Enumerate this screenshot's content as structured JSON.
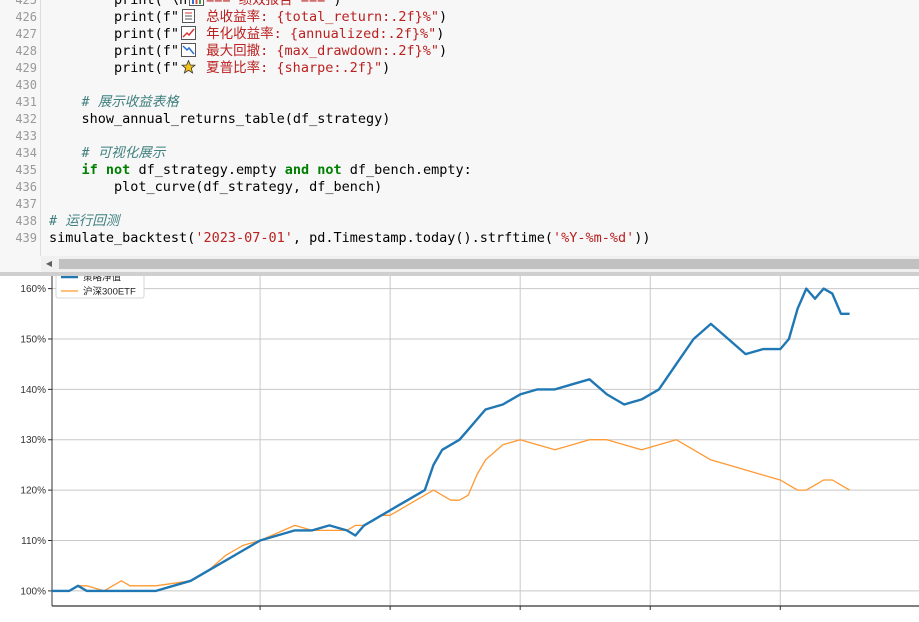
{
  "editor": {
    "lines": [
      {
        "n": "425",
        "parts": [
          [
            "",
            "        print(\"\\n"
          ],
          [
            "ic:bar",
            ""
          ],
          [
            "str",
            "=== 绩效报告 ===\""
          ],
          [
            "",
            ")"
          ]
        ]
      },
      {
        "n": "426",
        "parts": [
          [
            "",
            "        print(f\""
          ],
          [
            "ic:doc",
            ""
          ],
          [
            "str",
            " 总收益率: {total_return:.2f}%\""
          ],
          [
            "",
            ")"
          ]
        ]
      },
      {
        "n": "427",
        "parts": [
          [
            "",
            "        print(f\""
          ],
          [
            "ic:up",
            ""
          ],
          [
            "str",
            " 年化收益率: {annualized:.2f}%\""
          ],
          [
            "",
            ")"
          ]
        ]
      },
      {
        "n": "428",
        "parts": [
          [
            "",
            "        print(f\""
          ],
          [
            "ic:down",
            ""
          ],
          [
            "str",
            " 最大回撤: {max_drawdown:.2f}%\""
          ],
          [
            "",
            ")"
          ]
        ]
      },
      {
        "n": "429",
        "parts": [
          [
            "",
            "        print(f\""
          ],
          [
            "ic:star",
            ""
          ],
          [
            "str",
            " 夏普比率: {sharpe:.2f}\""
          ],
          [
            "",
            ")"
          ]
        ]
      },
      {
        "n": "430",
        "parts": []
      },
      {
        "n": "431",
        "parts": [
          [
            "",
            "    "
          ],
          [
            "cm",
            "# 展示收益表格"
          ]
        ]
      },
      {
        "n": "432",
        "parts": [
          [
            "",
            "    show_annual_returns_table(df_strategy)"
          ]
        ]
      },
      {
        "n": "433",
        "parts": []
      },
      {
        "n": "434",
        "parts": [
          [
            "",
            "    "
          ],
          [
            "cm",
            "# 可视化展示"
          ]
        ]
      },
      {
        "n": "435",
        "parts": [
          [
            "",
            "    "
          ],
          [
            "kw",
            "if"
          ],
          [
            "",
            " "
          ],
          [
            "kw",
            "not"
          ],
          [
            "",
            " df_strategy.empty "
          ],
          [
            "kw",
            "and"
          ],
          [
            "",
            " "
          ],
          [
            "kw",
            "not"
          ],
          [
            "",
            " df_bench.empty:"
          ]
        ]
      },
      {
        "n": "436",
        "parts": [
          [
            "",
            "        plot_curve(df_strategy, df_bench)"
          ]
        ]
      },
      {
        "n": "437",
        "parts": []
      },
      {
        "n": "438",
        "parts": [
          [
            "cm",
            "# 运行回测"
          ]
        ]
      },
      {
        "n": "439",
        "parts": [
          [
            "",
            "simulate_backtest("
          ],
          [
            "str",
            "'2023-07-01'"
          ],
          [
            "",
            ", pd.Timestamp.today().strftime("
          ],
          [
            "str",
            "'%Y-%m-%d'"
          ],
          [
            "",
            "))"
          ]
        ]
      }
    ],
    "scroll_left_glyph": "◀"
  },
  "chart_data": {
    "type": "line",
    "ylim": [
      0.97,
      1.625
    ],
    "xlim": [
      0,
      1000
    ],
    "yticks": [
      1.0,
      1.1,
      1.2,
      1.3,
      1.4,
      1.5,
      1.6
    ],
    "ytick_labels": [
      "100%",
      "110%",
      "120%",
      "130%",
      "140%",
      "150%",
      "160%"
    ],
    "xgrid": [
      240,
      390,
      540,
      690,
      840
    ],
    "grid": true,
    "legend": "top-left",
    "xlabel": "",
    "ylabel": "",
    "title": "",
    "series": [
      {
        "name": "策略净值",
        "color": "#1f77b4",
        "width": 2.4,
        "x": [
          0,
          20,
          30,
          40,
          60,
          70,
          80,
          90,
          120,
          160,
          180,
          200,
          220,
          240,
          280,
          300,
          320,
          340,
          350,
          360,
          370,
          380,
          390,
          400,
          410,
          420,
          430,
          440,
          450,
          460,
          470,
          480,
          490,
          500,
          520,
          540,
          560,
          580,
          600,
          620,
          640,
          660,
          680,
          700,
          720,
          740,
          760,
          780,
          800,
          820,
          840,
          850,
          860,
          870,
          880,
          890,
          900,
          910,
          920
        ],
        "y": [
          1.0,
          1.0,
          1.01,
          1.0,
          1.0,
          1.0,
          1.0,
          1.0,
          1.0,
          1.02,
          1.04,
          1.06,
          1.08,
          1.1,
          1.12,
          1.12,
          1.13,
          1.12,
          1.11,
          1.13,
          1.14,
          1.15,
          1.16,
          1.17,
          1.18,
          1.19,
          1.2,
          1.25,
          1.28,
          1.29,
          1.3,
          1.32,
          1.34,
          1.36,
          1.37,
          1.39,
          1.4,
          1.4,
          1.41,
          1.42,
          1.39,
          1.37,
          1.38,
          1.4,
          1.45,
          1.5,
          1.53,
          1.5,
          1.47,
          1.48,
          1.48,
          1.5,
          1.56,
          1.6,
          1.58,
          1.6,
          1.59,
          1.55,
          1.55
        ]
      },
      {
        "name": "沪深300ETF",
        "color": "#ff9933",
        "width": 1.3,
        "x": [
          0,
          20,
          30,
          40,
          60,
          70,
          80,
          90,
          120,
          160,
          180,
          200,
          220,
          240,
          280,
          300,
          320,
          340,
          350,
          360,
          370,
          380,
          390,
          400,
          410,
          420,
          430,
          440,
          450,
          460,
          470,
          480,
          490,
          500,
          520,
          540,
          560,
          580,
          600,
          620,
          640,
          660,
          680,
          700,
          720,
          740,
          760,
          780,
          800,
          820,
          840,
          850,
          860,
          870,
          880,
          890,
          900,
          910,
          920
        ],
        "y": [
          1.0,
          1.0,
          1.01,
          1.01,
          1.0,
          1.01,
          1.02,
          1.01,
          1.01,
          1.02,
          1.04,
          1.07,
          1.09,
          1.1,
          1.13,
          1.12,
          1.12,
          1.12,
          1.13,
          1.13,
          1.14,
          1.15,
          1.15,
          1.16,
          1.17,
          1.18,
          1.19,
          1.2,
          1.19,
          1.18,
          1.18,
          1.19,
          1.23,
          1.26,
          1.29,
          1.3,
          1.29,
          1.28,
          1.29,
          1.3,
          1.3,
          1.29,
          1.28,
          1.29,
          1.3,
          1.28,
          1.26,
          1.25,
          1.24,
          1.23,
          1.22,
          1.21,
          1.2,
          1.2,
          1.21,
          1.22,
          1.22,
          1.21,
          1.2
        ]
      }
    ]
  }
}
